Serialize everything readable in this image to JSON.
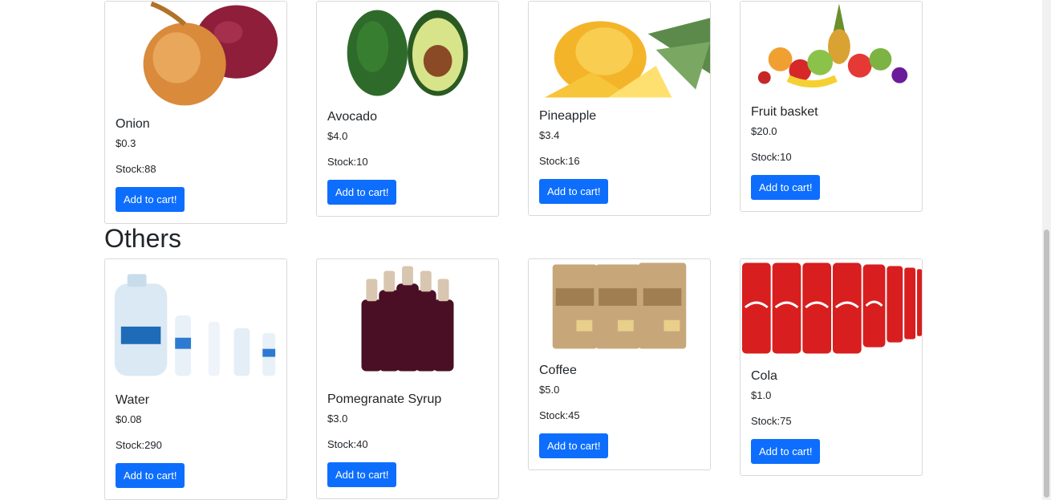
{
  "fruits": [
    {
      "name": "Onion",
      "price": "$0.3",
      "stock": "Stock:88",
      "button": "Add to cart!",
      "image": "onion-image"
    },
    {
      "name": "Avocado",
      "price": "$4.0",
      "stock": "Stock:10",
      "button": "Add to cart!",
      "image": "avocado-image"
    },
    {
      "name": "Pineapple",
      "price": "$3.4",
      "stock": "Stock:16",
      "button": "Add to cart!",
      "image": "pineapple-image"
    },
    {
      "name": "Fruit basket",
      "price": "$20.0",
      "stock": "Stock:10",
      "button": "Add to cart!",
      "image": "fruit-basket-image"
    }
  ],
  "others_title": "Others",
  "others": [
    {
      "name": "Water",
      "price": "$0.08",
      "stock": "Stock:290",
      "button": "Add to cart!",
      "image": "water-bottles-image"
    },
    {
      "name": "Pomegranate Syrup",
      "price": "$3.0",
      "stock": "Stock:40",
      "button": "Add to cart!",
      "image": "syrup-bottles-image"
    },
    {
      "name": "Coffee",
      "price": "$5.0",
      "stock": "Stock:45",
      "button": "Add to cart!",
      "image": "coffee-bags-image"
    },
    {
      "name": "Cola",
      "price": "$1.0",
      "stock": "Stock:75",
      "button": "Add to cart!",
      "image": "cola-cans-image"
    }
  ],
  "colors": {
    "button": "#0d6efd",
    "border": "#d9d9d9",
    "text": "#212529"
  }
}
